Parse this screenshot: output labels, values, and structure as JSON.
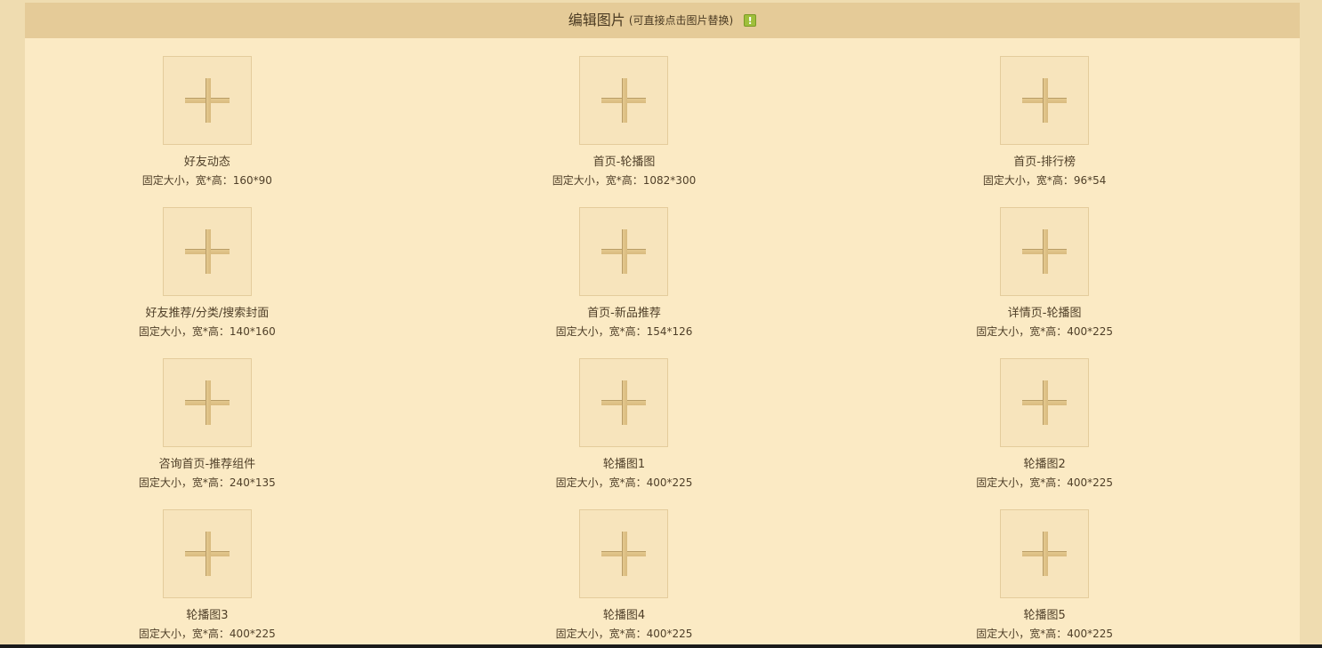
{
  "header": {
    "title": "编辑图片",
    "hint": "(可直接点击图片替换)",
    "info_icon": "!"
  },
  "cards": [
    {
      "title": "好友动态",
      "spec": "固定大小，宽*高：160*90"
    },
    {
      "title": "首页-轮播图",
      "spec": "固定大小，宽*高：1082*300"
    },
    {
      "title": "首页-排行榜",
      "spec": "固定大小，宽*高：96*54"
    },
    {
      "title": "好友推荐/分类/搜索封面",
      "spec": "固定大小，宽*高：140*160"
    },
    {
      "title": "首页-新品推荐",
      "spec": "固定大小，宽*高：154*126"
    },
    {
      "title": "详情页-轮播图",
      "spec": "固定大小，宽*高：400*225"
    },
    {
      "title": "咨询首页-推荐组件",
      "spec": "固定大小，宽*高：240*135"
    },
    {
      "title": "轮播图1",
      "spec": "固定大小，宽*高：400*225"
    },
    {
      "title": "轮播图2",
      "spec": "固定大小，宽*高：400*225"
    },
    {
      "title": "轮播图3",
      "spec": "固定大小，宽*高：400*225"
    },
    {
      "title": "轮播图4",
      "spec": "固定大小，宽*高：400*225"
    },
    {
      "title": "轮播图5",
      "spec": "固定大小，宽*高：400*225"
    }
  ]
}
